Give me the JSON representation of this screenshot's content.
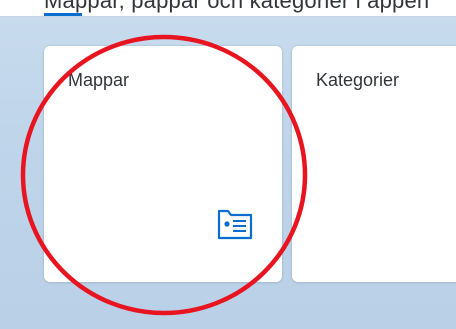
{
  "header": {
    "cut_text": "Mappar, pappar och kategorier i appen"
  },
  "tiles": [
    {
      "title": "Mappar",
      "icon": "folder-card-icon"
    },
    {
      "title": "Kategorier"
    }
  ],
  "colors": {
    "background": "#bfd5ea",
    "tile": "#ffffff",
    "text": "#32363a",
    "icon": "#0a6ed1",
    "annotation": "#e8141f"
  }
}
